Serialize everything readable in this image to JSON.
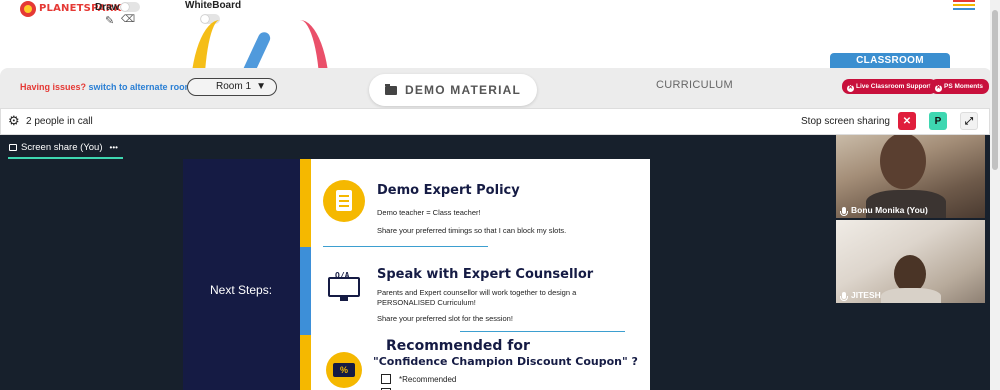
{
  "brand": {
    "name": "PLANETSPARK"
  },
  "tools": {
    "draw_label": "Draw",
    "whiteboard_label": "WhiteBoard"
  },
  "classroom": {
    "tab_label": "CLASSROOM",
    "live_support_label": "Live Classroom Support",
    "ps_moments_label": "PS Moments"
  },
  "roombar": {
    "issues_text": "Having issues?",
    "alternate_link": "switch to alternate room",
    "room_value": "Room 1",
    "demo_material_label": "DEMO MATERIAL",
    "curriculum_label": "CURRICULUM"
  },
  "call": {
    "people_count_text": "2 people in call",
    "stop_share_label": "Stop screen sharing",
    "close_symbol": "✕",
    "avatar_letter": "P",
    "expand_symbol": "⤢"
  },
  "screen_share": {
    "tab_label": "Screen share (You)",
    "more_symbol": "•••"
  },
  "slide": {
    "left_label": "Next Steps:",
    "section1": {
      "title": "Demo Expert Policy",
      "line1": "Demo teacher = Class teacher!",
      "line2": "Share your preferred timings so that I can block my slots."
    },
    "section2": {
      "title": "Speak with Expert Counsellor",
      "line1": "Parents and Expert counsellor will work together to design a",
      "line2": "PERSONALISED Curriculum!",
      "line3": "Share your preferred slot for the session!",
      "icon_text": "Q/A"
    },
    "section3": {
      "title": "Recommended for",
      "subtitle": "\"Confidence Champion Discount Coupon\" ?",
      "option1": "*Recommended",
      "icon_text": "%"
    }
  },
  "participants": [
    {
      "name": "Bonu Monika (You)"
    },
    {
      "name": "JITESH"
    }
  ],
  "colors": {
    "brand_red": "#e53935",
    "link_blue": "#2a7fd4",
    "pill_red": "#c8103c",
    "classroom_blue": "#3b8fd0",
    "accent_green": "#3ed7b1",
    "slide_navy": "#151b44",
    "slide_yellow": "#f5b800",
    "slide_blue": "#3d8fd8",
    "stage_dark": "#17202c"
  }
}
